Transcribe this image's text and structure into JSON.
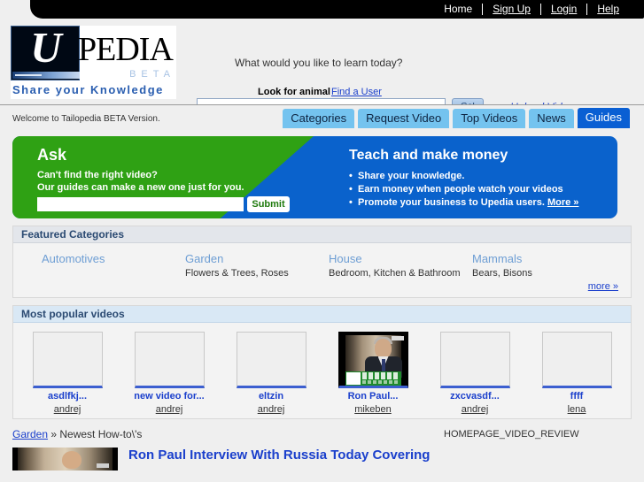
{
  "topnav": {
    "links": [
      {
        "label": "Home",
        "underlined": false
      },
      {
        "label": "Sign Up",
        "underlined": true
      },
      {
        "label": "Login",
        "underlined": true
      },
      {
        "label": "Help",
        "underlined": true
      }
    ]
  },
  "logo": {
    "letter": "U",
    "word": "PEDIA",
    "beta": "BETA",
    "tagline": "Share your Knowledge"
  },
  "header": {
    "question": "What would you like to learn today?",
    "look_for_label": "Look for animal",
    "find_a_user": "Find a User",
    "search_value": "",
    "search_placeholder": "",
    "go_label": "Go!",
    "upload_videos": "Upload Videos"
  },
  "navrow": {
    "welcome": "Welcome to Tailopedia BETA Version.",
    "tabs": [
      {
        "label": "Categories",
        "active": false
      },
      {
        "label": "Request Video",
        "active": false
      },
      {
        "label": "Top Videos",
        "active": false
      },
      {
        "label": "News",
        "active": false
      },
      {
        "label": "Guides",
        "active": true
      }
    ]
  },
  "promo": {
    "ask_title": "Ask",
    "ask_line1": "Can't find the right video?",
    "ask_line2": "Our guides can make a new one just for you.",
    "ask_input_value": "",
    "submit_label": "Submit",
    "teach_title": "Teach and make money",
    "bullets": [
      "Share your knowledge.",
      "Earn money when people watch your videos",
      "Promote your business to Upedia users."
    ],
    "more_label": "More »"
  },
  "featured": {
    "heading": "Featured Categories",
    "categories": [
      {
        "title": "Automotives",
        "subs": ""
      },
      {
        "title": "Garden",
        "subs": "Flowers & Trees, Roses"
      },
      {
        "title": "House",
        "subs": "Bedroom, Kitchen & Bathroom"
      },
      {
        "title": "Mammals",
        "subs": "Bears, Bisons"
      }
    ],
    "more_label": "more »"
  },
  "popular": {
    "heading": "Most popular videos",
    "videos": [
      {
        "title": "asdlfkj...",
        "author": "andrej",
        "has_image": false
      },
      {
        "title": "new video for...",
        "author": "andrej",
        "has_image": false
      },
      {
        "title": "eltzin",
        "author": "andrej",
        "has_image": false
      },
      {
        "title": "Ron Paul...",
        "author": "mikeben",
        "has_image": true
      },
      {
        "title": "zxcvasdf...",
        "author": "andrej",
        "has_image": false
      },
      {
        "title": "ffff",
        "author": "lena",
        "has_image": false
      }
    ]
  },
  "bottom": {
    "crumb_link": "Garden",
    "crumb_rest": " » Newest How-to\\'s",
    "review_label": "HOMEPAGE_VIDEO_REVIEW",
    "video_title": "Ron Paul Interview With Russia Today Covering"
  },
  "colors": {
    "green": "#2fa114",
    "blue": "#0a62cc",
    "tab": "#74c3ef",
    "tab_active": "#0a5fd3",
    "link": "#1a3fcc",
    "category": "#6e9ed4",
    "panel_head_text": "#2b4a72"
  }
}
